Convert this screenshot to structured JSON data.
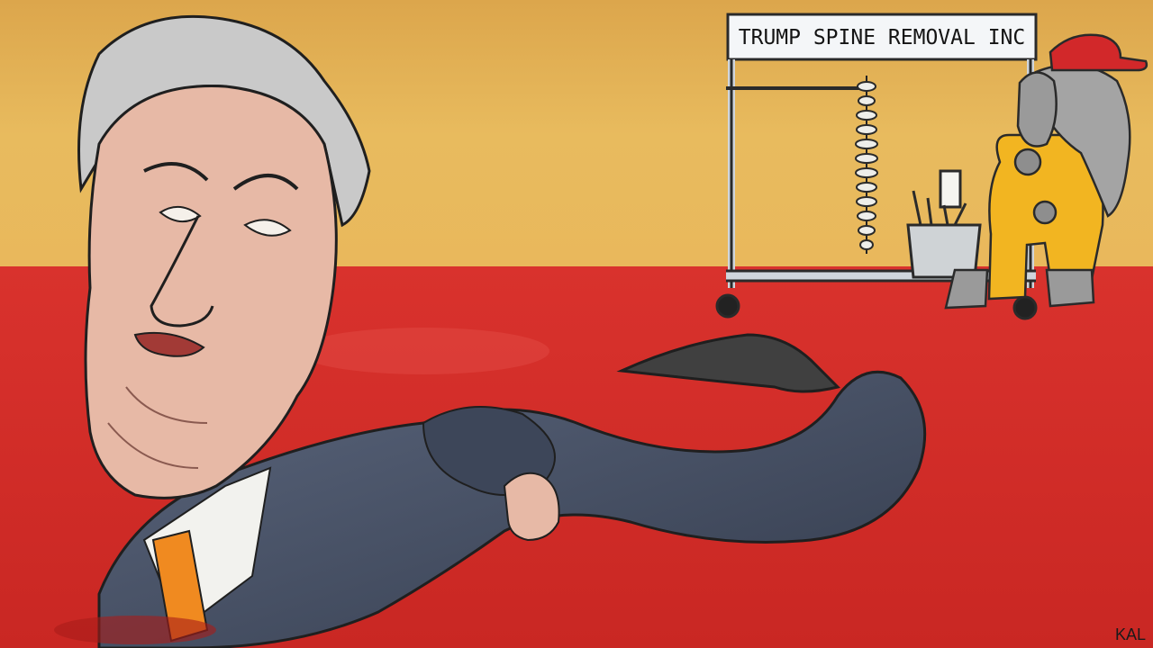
{
  "cartoon": {
    "sign_text": "TRUMP SPINE REMOVAL INC",
    "artist_signature": "KAL"
  },
  "palette": {
    "wall": "#e2b458",
    "floor": "#d9302c",
    "suit": "#4a5468",
    "skin": "#e7b9a6",
    "hair": "#c9c9c9",
    "jumpsuit": "#f2b521",
    "cap": "#d2282a",
    "elephant": "#9a9a9a",
    "cart_frame": "#cdd3da"
  },
  "icons": [
    "caricature-figure-icon",
    "spine-icon",
    "elephant-icon",
    "surgical-cart-icon"
  ]
}
